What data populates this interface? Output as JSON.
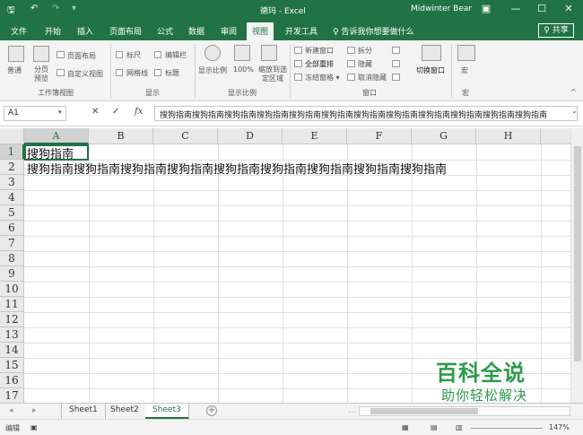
{
  "titlebar": {
    "title": "德玛 - Excel",
    "user": "Midwinter Bear",
    "save_glyph": "🖫",
    "undo_glyph": "↶",
    "redo_glyph": "↷",
    "customize_glyph": "▾",
    "ribbon_opts_glyph": "▣",
    "minimize_glyph": "—",
    "maximize_glyph": "☐",
    "close_glyph": "✕",
    "bg_color": "#217346"
  },
  "tabs": [
    {
      "label": "文件"
    },
    {
      "label": "开始"
    },
    {
      "label": "插入"
    },
    {
      "label": "页面布局"
    },
    {
      "label": "公式"
    },
    {
      "label": "数据"
    },
    {
      "label": "审阅"
    },
    {
      "label": "视图"
    },
    {
      "label": "开发工具"
    }
  ],
  "tellme": "♀ 告诉我你想要做什么",
  "share": "♀ 共享",
  "ribbon": {
    "workbook_views": {
      "label": "工作簿视图",
      "normal": "普通",
      "page_break": "分页预览",
      "page_layout": "页面布局",
      "custom_views": "自定义视图"
    },
    "show": {
      "label": "显示",
      "ruler": "标尺",
      "formula_bar": "编辑栏",
      "gridlines": "网格线",
      "headings": "标题"
    },
    "zoom": {
      "label": "显示比例",
      "zoom": "显示比例",
      "zoom100": "100%",
      "zoom_selection": "缩放到选定区域"
    },
    "window": {
      "label": "窗口",
      "new_window": "新建窗口",
      "arrange_all": "全部重排",
      "freeze": "冻结窗格 ▾",
      "split": "拆分",
      "hide": "隐藏",
      "unhide": "取消隐藏",
      "switch": "切换窗口"
    },
    "macros": {
      "label": "宏",
      "macro": "宏"
    }
  },
  "formula_bar": {
    "name_box": "A1",
    "cancel": "✕",
    "enter": "✓",
    "fx": "fx",
    "content": "搜狗指南搜狗指南搜狗指南搜狗指南搜狗指南搜狗指南搜狗指南搜狗指南搜狗指南搜狗指南搜狗指南搜狗指南"
  },
  "grid": {
    "columns": [
      "A",
      "B",
      "C",
      "D",
      "E",
      "F",
      "G",
      "H"
    ],
    "rows": [
      "1",
      "2",
      "3",
      "4",
      "5",
      "6",
      "7",
      "8",
      "9",
      "10",
      "11",
      "12",
      "13",
      "14",
      "15",
      "16",
      "17"
    ],
    "cell_a1": "搜狗指南",
    "cell_a2": "搜狗指南搜狗指南搜狗指南搜狗指南搜狗指南搜狗指南搜狗指南搜狗指南搜狗指南"
  },
  "sheets": {
    "tabs": [
      "Sheet1",
      "Sheet2",
      "Sheet3"
    ],
    "active": "Sheet3",
    "add": "+",
    "nav_prev": "◂",
    "nav_next": "▸",
    "more": "…"
  },
  "status": {
    "mode": "编辑",
    "zoom": "147%"
  },
  "watermark": {
    "title": "百科全说",
    "subtitle": "助你轻松解决"
  }
}
